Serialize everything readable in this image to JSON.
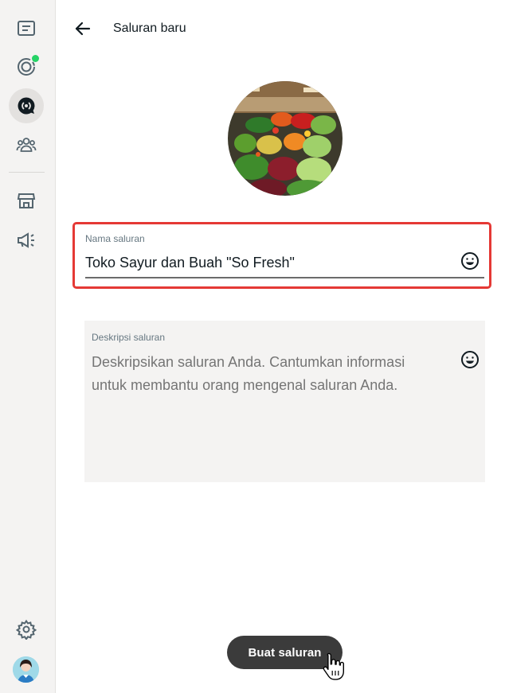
{
  "sidebar": {
    "items": [
      {
        "name": "chats-icon"
      },
      {
        "name": "status-icon",
        "has_dot": true
      },
      {
        "name": "channels-icon",
        "active": true
      },
      {
        "name": "communities-icon"
      },
      {
        "name": "store-icon"
      },
      {
        "name": "announcements-icon"
      },
      {
        "name": "settings-icon"
      }
    ],
    "status_dot_color": "#25d366"
  },
  "header": {
    "title": "Saluran baru"
  },
  "form": {
    "name_label": "Nama saluran",
    "name_value": "Toko Sayur dan Buah \"So Fresh\"",
    "description_label": "Deskripsi saluran",
    "description_placeholder": "Deskripsikan saluran Anda. Cantumkan informasi untuk membantu orang mengenal saluran Anda."
  },
  "actions": {
    "create_label": "Buat saluran"
  },
  "colors": {
    "highlight_border": "#e53935",
    "button_bg": "#3b3b3b",
    "sidebar_bg": "#f4f3f2"
  }
}
